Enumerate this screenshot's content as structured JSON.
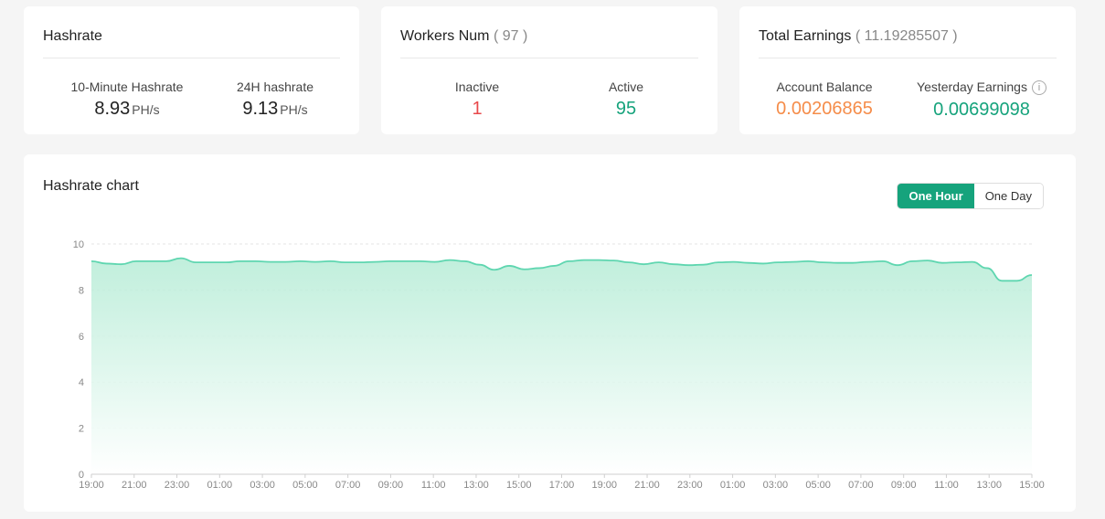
{
  "hashrate_card": {
    "title": "Hashrate",
    "ten_min_label": "10-Minute Hashrate",
    "ten_min_value": "8.93",
    "ten_min_unit": "PH/s",
    "day_label": "24H hashrate",
    "day_value": "9.13",
    "day_unit": "PH/s"
  },
  "workers_card": {
    "title": "Workers Num",
    "count": "( 97 )",
    "inactive_label": "Inactive",
    "inactive_value": "1",
    "active_label": "Active",
    "active_value": "95"
  },
  "earnings_card": {
    "title": "Total Earnings",
    "total": "( 11.19285507 )",
    "balance_label": "Account Balance",
    "balance_value": "0.00206865",
    "yesterday_label": "Yesterday Earnings",
    "yesterday_value": "0.00699098",
    "info_glyph": "i"
  },
  "chart_card": {
    "title": "Hashrate chart",
    "toggle_one_hour": "One Hour",
    "toggle_one_day": "One Day"
  },
  "colors": {
    "accent": "#16a37c",
    "inactive": "#e8494b",
    "balance": "#f58c49",
    "line": "#5fd6b0",
    "fill": "#b6ecd6"
  },
  "chart_data": {
    "type": "area",
    "ylim": [
      0,
      10
    ],
    "yticks": [
      0,
      2,
      4,
      6,
      8,
      10
    ],
    "xticks": [
      "19:00",
      "21:00",
      "23:00",
      "01:00",
      "03:00",
      "05:00",
      "07:00",
      "09:00",
      "11:00",
      "13:00",
      "15:00",
      "17:00",
      "19:00",
      "21:00",
      "23:00",
      "01:00",
      "03:00",
      "05:00",
      "07:00",
      "09:00",
      "11:00",
      "13:00",
      "15:00"
    ],
    "series": [
      {
        "values": [
          9.25,
          9.15,
          9.12,
          9.25,
          9.25,
          9.25,
          9.38,
          9.2,
          9.2,
          9.2,
          9.25,
          9.25,
          9.22,
          9.22,
          9.25,
          9.22,
          9.25,
          9.2,
          9.2,
          9.22,
          9.25,
          9.25,
          9.25,
          9.22,
          9.3,
          9.25,
          9.1,
          8.88,
          9.05,
          8.9,
          8.95,
          9.05,
          9.25,
          9.3,
          9.3,
          9.28,
          9.2,
          9.12,
          9.2,
          9.12,
          9.08,
          9.1,
          9.2,
          9.22,
          9.18,
          9.15,
          9.2,
          9.22,
          9.25,
          9.2,
          9.18,
          9.18,
          9.22,
          9.25,
          9.08,
          9.25,
          9.28,
          9.18,
          9.2,
          9.22,
          8.95,
          8.4,
          8.4,
          8.65
        ]
      }
    ]
  }
}
